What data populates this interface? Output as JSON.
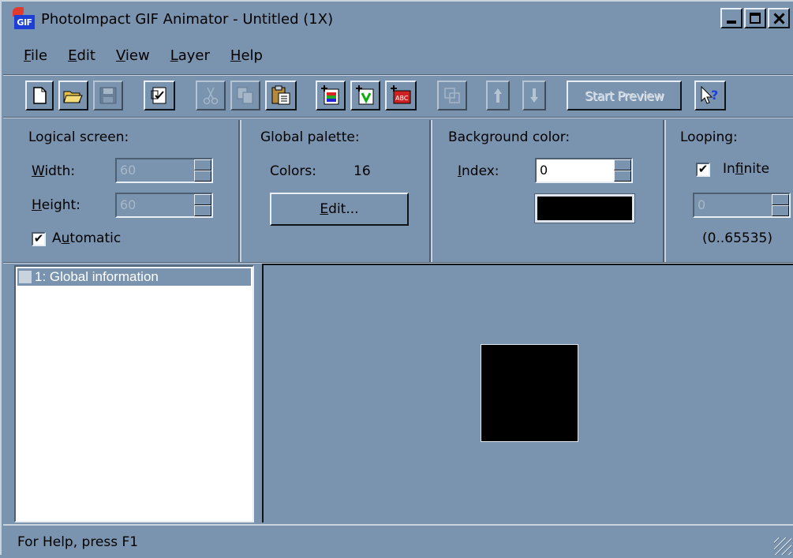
{
  "window": {
    "title": "PhotoImpact GIF Animator - Untitled (1X)",
    "icon_label": "GIF"
  },
  "menu": {
    "items": [
      {
        "key": "F",
        "rest": "ile"
      },
      {
        "key": "E",
        "rest": "dit"
      },
      {
        "key": "V",
        "rest": "iew"
      },
      {
        "key": "L",
        "rest": "ayer"
      },
      {
        "key": "H",
        "rest": "elp"
      }
    ]
  },
  "toolbar": {
    "start_preview_label": "Start Preview",
    "icons": [
      "new-icon",
      "open-icon",
      "save-icon",
      "properties-icon",
      "cut-icon",
      "copy-icon",
      "paste-icon",
      "add-image-icon",
      "add-video-icon",
      "add-banner-text-icon",
      "optimize-icon",
      "move-up-icon",
      "move-down-icon",
      "context-help-icon"
    ]
  },
  "logical_screen": {
    "heading": "Logical screen:",
    "width_key": "W",
    "width_rest": "idth:",
    "width_value": "60",
    "height_key": "H",
    "height_rest": "eight:",
    "height_value": "60",
    "automatic_pre": "A",
    "automatic_key": "u",
    "automatic_rest": "tomatic",
    "automatic_checked": "✔"
  },
  "global_palette": {
    "heading": "Global palette:",
    "colors_label": "Colors:",
    "colors_value": "16",
    "edit_key": "E",
    "edit_rest": "dit..."
  },
  "background_color": {
    "heading": "Background color:",
    "index_key": "I",
    "index_rest": "ndex:",
    "index_value": "0",
    "swatch_color": "#000000"
  },
  "looping": {
    "heading": "Looping:",
    "infinite_pre": "In",
    "infinite_key": "f",
    "infinite_rest": "inite",
    "infinite_checked": "✔",
    "count_value": "0",
    "range_text": "(0..65535)"
  },
  "frames": {
    "items": [
      {
        "label": "1: Global information"
      }
    ]
  },
  "canvas": {
    "frame_color": "#000000"
  },
  "status": {
    "text": "For Help, press F1"
  }
}
